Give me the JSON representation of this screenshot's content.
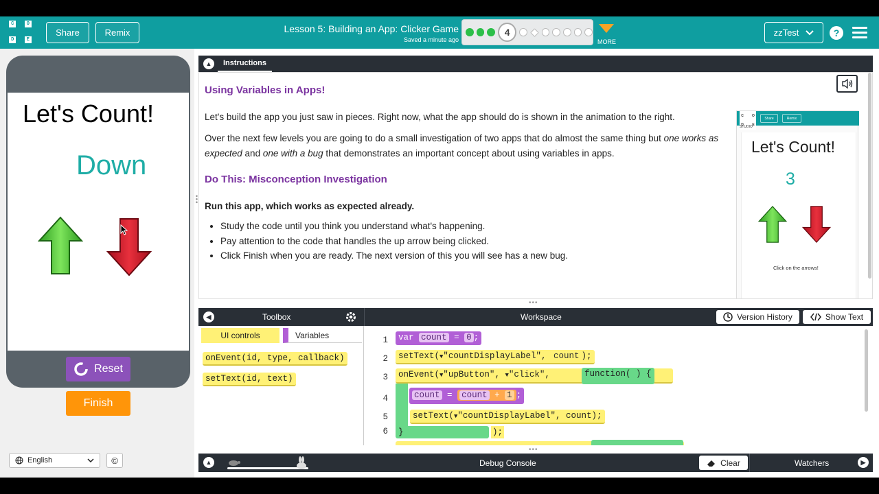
{
  "header": {
    "logo_letters": [
      "C",
      "O",
      "D",
      "E"
    ],
    "share_label": "Share",
    "remix_label": "Remix",
    "lesson_title": "Lesson 5: Building an App: Clicker Game",
    "saved_status": "Saved a minute ago",
    "current_level": "4",
    "more_label": "MORE",
    "user_name": "zzTest",
    "help_glyph": "?"
  },
  "app_preview": {
    "title": "Let's Count!",
    "value": "Down",
    "reset_label": "Reset",
    "finish_label": "Finish",
    "language": "English",
    "copyright_glyph": "©",
    "colors": {
      "value_text": "#1fada6",
      "reset_bg": "#8c52ba",
      "finish_bg": "#ff9509"
    }
  },
  "instructions": {
    "tab_label": "Instructions",
    "heading1": "Using Variables in Apps!",
    "para1": "Let's build the app you just saw in pieces. Right now, what the app should do is shown in the animation to the right.",
    "para2_a": "Over the next few levels you are going to do a small investigation of two apps that do almost the same thing but ",
    "para2_em1": "one works as expected",
    "para2_b": " and ",
    "para2_em2": "one with a bug",
    "para2_c": " that demonstrates an important concept about using variables in apps.",
    "heading2": "Do This: Misconception Investigation",
    "bold_line": "Run this app, which works as expected already.",
    "bullets": [
      "Study the code until you think you understand what's happening.",
      "Pay attention to the code that handles the up arrow being clicked.",
      "Click Finish when you are ready. The next version of this you will see has a new bug."
    ],
    "animation": {
      "logo_letters": [
        "C",
        "O",
        "D",
        "E"
      ],
      "studio_label": "STUDIO",
      "share_label": "Share",
      "remix_label": "Remix",
      "title": "Let's Count!",
      "value": "3",
      "caption": "Click on the arrows!"
    }
  },
  "toolbox": {
    "title": "Toolbox",
    "categories": [
      "UI controls",
      "Variables"
    ],
    "blocks": [
      "onEvent(id, type, callback)",
      "setText(id, text)"
    ]
  },
  "workspace": {
    "title": "Workspace",
    "version_history_label": "Version History",
    "show_text_label": "Show Text",
    "line_numbers": [
      "1",
      "2",
      "3",
      "4",
      "5",
      "6"
    ],
    "code": {
      "l1_kw": "var",
      "l1_name": "count",
      "l1_eq": "=",
      "l1_val": "0",
      "l1_end": ";",
      "l2_fn": "setText(",
      "l2_str": "\"countDisplayLabel\"",
      "l2_arg": "count",
      "l2_end": ");",
      "l3_fn": "onEvent(",
      "l3_str1": "\"upButton\"",
      "l3_str2": "\"click\"",
      "l3_func": "function( ) {",
      "l4_name": "count",
      "l4_eq": "=",
      "l4_ref": "count",
      "l4_plus": "+",
      "l4_num": "1",
      "l4_end": ";",
      "l5_fn": "setText(",
      "l5_str": "\"countDisplayLabel\"",
      "l5_arg": "count",
      "l5_end": ");",
      "l6_close": "}",
      "l6_end": ");"
    }
  },
  "debug": {
    "title": "Debug Console",
    "clear_label": "Clear",
    "watchers_label": "Watchers"
  }
}
